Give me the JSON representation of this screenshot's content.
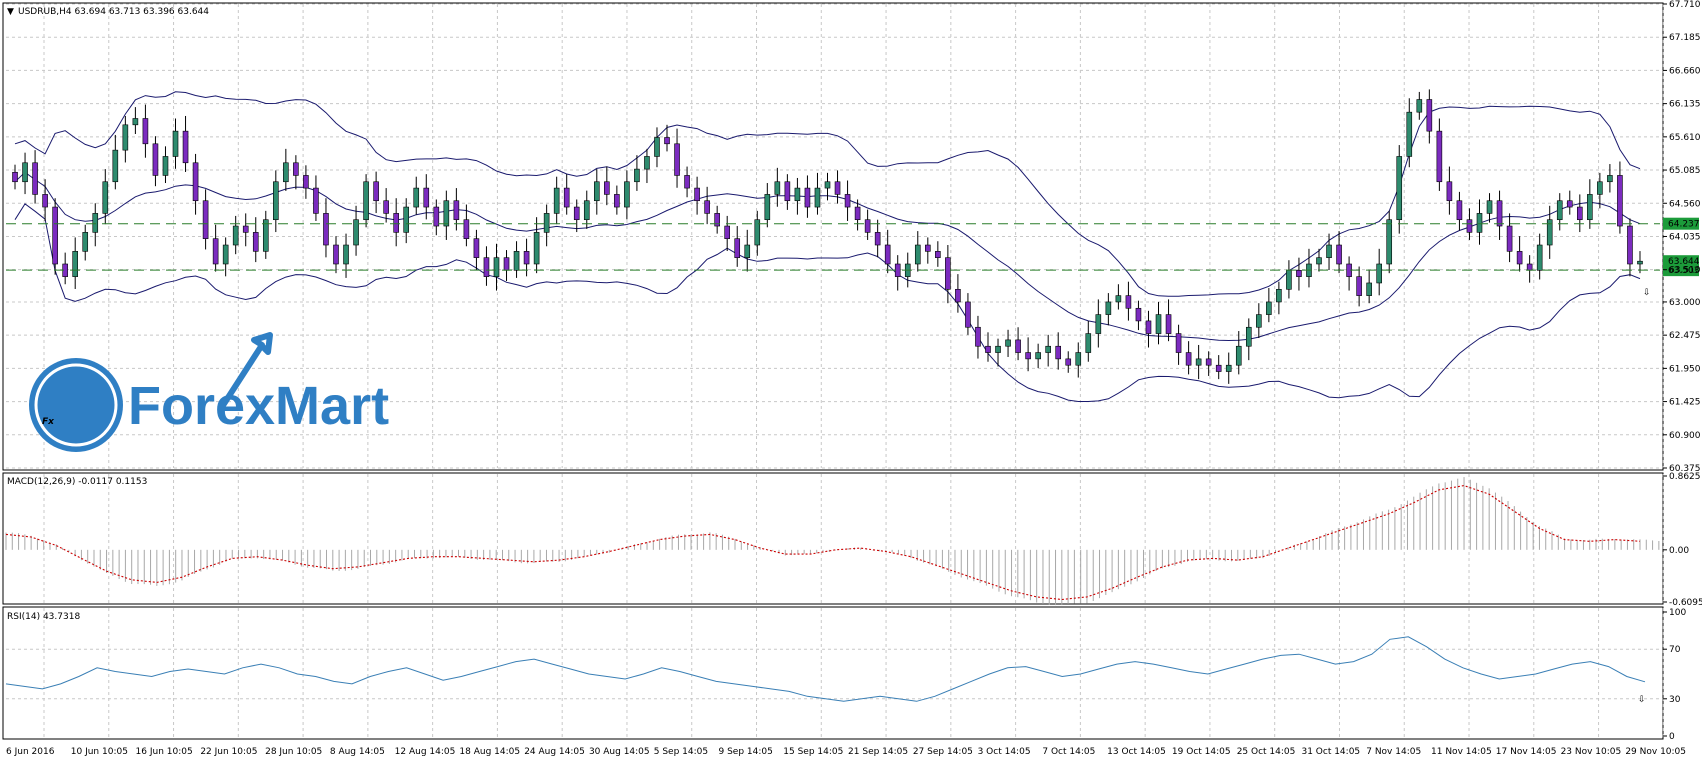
{
  "main_panel": {
    "header": "USDRUB,H4  63.694 63.713 63.396 63.644",
    "price_levels": [
      "67.710",
      "67.185",
      "66.660",
      "66.135",
      "65.610",
      "65.085",
      "64.560",
      "64.035",
      "63.510",
      "63.000",
      "62.475",
      "61.950",
      "61.425",
      "60.900",
      "60.375"
    ],
    "price_tags": [
      {
        "value": "64.237",
        "color": "#1c9b3a"
      },
      {
        "value": "63.644",
        "color": "#1c9b3a"
      },
      {
        "value": "63.503",
        "color": "#1c9b3a"
      }
    ],
    "signal_icon": "down-arrow-icon"
  },
  "logo": {
    "text": "ForexMart",
    "icon": "fx-logo-icon",
    "color": "#2f7fc4"
  },
  "macd_panel": {
    "header": "MACD(12,26,9) -0.0117 0.1153",
    "levels": [
      "0.8625",
      "0.00",
      "-0.6095"
    ]
  },
  "rsi_panel": {
    "header": "RSI(14) 43.7318",
    "levels": [
      "100",
      "70",
      "30",
      "0"
    ],
    "signal_icon": "down-arrow-icon"
  },
  "x_axis_labels": [
    "6 Jun 2016",
    "10 Jun 10:05",
    "16 Jun 10:05",
    "22 Jun 10:05",
    "28 Jun 10:05",
    "8 Aug 14:05",
    "12 Aug 14:05",
    "18 Aug 14:05",
    "24 Aug 14:05",
    "30 Aug 14:05",
    "5 Sep 14:05",
    "9 Sep 14:05",
    "15 Sep 14:05",
    "21 Sep 14:05",
    "27 Sep 14:05",
    "3 Oct 14:05",
    "7 Oct 14:05",
    "13 Oct 14:05",
    "19 Oct 14:05",
    "25 Oct 14:05",
    "31 Oct 14:05",
    "7 Nov 14:05",
    "11 Nov 14:05",
    "17 Nov 14:05",
    "23 Nov 10:05",
    "29 Nov 10:05"
  ],
  "colors": {
    "bull": "#2e8b6e",
    "bear": "#7b2bbf",
    "band": "#1a1a6e",
    "hline": "#2a7d2a",
    "macd_signal": "#cc0000",
    "rsi": "#3a7fb5",
    "grid": "#c8c8c8",
    "axis": "#000000"
  },
  "chart_data": [
    {
      "type": "candlestick",
      "title": "USDRUB,H4",
      "ylim": [
        60.375,
        67.71
      ],
      "last": {
        "open": 63.694,
        "high": 63.713,
        "low": 63.396,
        "close": 63.644
      },
      "horizontal_lines": [
        64.237,
        63.503
      ],
      "close_path": [
        64.9,
        65.2,
        64.7,
        64.5,
        63.6,
        63.4,
        63.8,
        64.1,
        64.4,
        64.9,
        65.4,
        65.8,
        65.9,
        65.5,
        65.0,
        65.3,
        65.7,
        65.2,
        64.6,
        64.0,
        63.6,
        63.9,
        64.2,
        64.1,
        63.8,
        64.3,
        64.9,
        65.2,
        65.0,
        64.8,
        64.4,
        63.9,
        63.6,
        63.9,
        64.3,
        64.9,
        64.6,
        64.4,
        64.1,
        64.5,
        64.8,
        64.5,
        64.2,
        64.6,
        64.3,
        64.0,
        63.7,
        63.4,
        63.7,
        63.5,
        63.8,
        63.6,
        64.1,
        64.4,
        64.8,
        64.5,
        64.3,
        64.6,
        64.9,
        64.7,
        64.5,
        64.9,
        65.1,
        65.3,
        65.6,
        65.5,
        65.0,
        64.8,
        64.6,
        64.4,
        64.2,
        64.0,
        63.7,
        63.9,
        64.3,
        64.7,
        64.9,
        64.6,
        64.8,
        64.5,
        64.8,
        64.9,
        64.7,
        64.5,
        64.3,
        64.1,
        63.9,
        63.6,
        63.4,
        63.6,
        63.9,
        63.8,
        63.7,
        63.2,
        63.0,
        62.6,
        62.3,
        62.2,
        62.3,
        62.4,
        62.2,
        62.1,
        62.2,
        62.3,
        62.1,
        62.0,
        62.2,
        62.5,
        62.8,
        63.0,
        63.1,
        62.9,
        62.7,
        62.5,
        62.8,
        62.5,
        62.2,
        62.0,
        62.1,
        62.0,
        61.9,
        62.0,
        62.3,
        62.6,
        62.8,
        63.0,
        63.2,
        63.5,
        63.4,
        63.6,
        63.7,
        63.9,
        63.6,
        63.4,
        63.1,
        63.3,
        63.6,
        64.3,
        65.3,
        66.0,
        66.2,
        65.7,
        64.9,
        64.6,
        64.3,
        64.1,
        64.4,
        64.6,
        64.2,
        63.8,
        63.6,
        63.5,
        63.9,
        64.3,
        64.6,
        64.5,
        64.3,
        64.7,
        64.9,
        65.0,
        64.2,
        63.6,
        63.644
      ]
    },
    {
      "type": "line",
      "title": "MACD(12,26,9)",
      "values": {
        "macd": -0.0117,
        "signal": 0.1153
      },
      "ylim": [
        -0.6095,
        0.8625
      ],
      "signal_path": [
        0.18,
        0.15,
        0.05,
        -0.1,
        -0.25,
        -0.35,
        -0.38,
        -0.32,
        -0.2,
        -0.1,
        -0.08,
        -0.12,
        -0.18,
        -0.22,
        -0.2,
        -0.15,
        -0.1,
        -0.08,
        -0.08,
        -0.1,
        -0.12,
        -0.14,
        -0.12,
        -0.08,
        -0.02,
        0.05,
        0.12,
        0.16,
        0.18,
        0.12,
        0.02,
        -0.05,
        -0.05,
        0.0,
        0.02,
        -0.02,
        -0.08,
        -0.18,
        -0.28,
        -0.38,
        -0.48,
        -0.55,
        -0.58,
        -0.55,
        -0.45,
        -0.32,
        -0.2,
        -0.12,
        -0.1,
        -0.12,
        -0.08,
        0.02,
        0.12,
        0.22,
        0.32,
        0.42,
        0.55,
        0.7,
        0.75,
        0.65,
        0.45,
        0.25,
        0.12,
        0.1,
        0.12,
        0.1
      ]
    },
    {
      "type": "line",
      "title": "RSI(14)",
      "values": {
        "rsi": 43.7318
      },
      "ylim": [
        0,
        100
      ],
      "levels": [
        70,
        30
      ],
      "rsi_path": [
        42,
        40,
        38,
        42,
        48,
        55,
        52,
        50,
        48,
        52,
        54,
        52,
        50,
        55,
        58,
        55,
        50,
        48,
        44,
        42,
        48,
        52,
        55,
        50,
        45,
        48,
        52,
        56,
        60,
        62,
        58,
        54,
        50,
        48,
        46,
        50,
        55,
        52,
        48,
        44,
        42,
        40,
        38,
        36,
        32,
        30,
        28,
        30,
        32,
        30,
        28,
        32,
        38,
        44,
        50,
        55,
        56,
        52,
        48,
        50,
        54,
        58,
        60,
        58,
        55,
        52,
        50,
        54,
        58,
        62,
        65,
        66,
        62,
        58,
        60,
        66,
        78,
        80,
        72,
        62,
        55,
        50,
        46,
        48,
        50,
        54,
        58,
        60,
        56,
        48,
        43.7
      ]
    }
  ]
}
